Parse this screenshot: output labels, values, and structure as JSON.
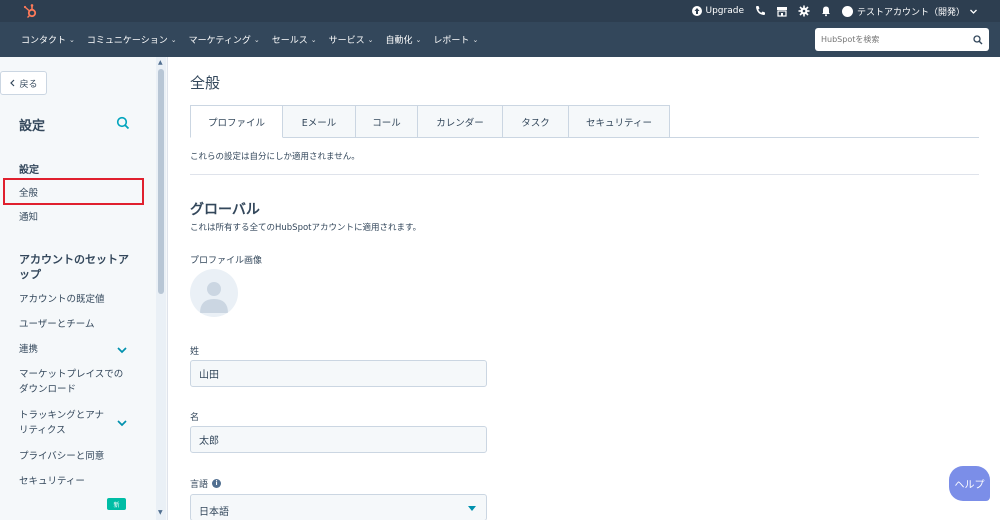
{
  "topbar": {
    "upgrade_label": "Upgrade",
    "account_label": "テストアカウント（開発）",
    "brand_color": "#ff7a59"
  },
  "nav": {
    "items": [
      {
        "label": "コンタクト"
      },
      {
        "label": "コミュニケーション"
      },
      {
        "label": "マーケティング"
      },
      {
        "label": "セールス"
      },
      {
        "label": "サービス"
      },
      {
        "label": "自動化"
      },
      {
        "label": "レポート"
      }
    ],
    "search_placeholder": "HubSpotを検索"
  },
  "sidebar": {
    "back_label": "戻る",
    "title": "設定",
    "section_settings": "設定",
    "item_general": "全般",
    "item_notifications": "通知",
    "section_account": "アカウントのセットアップ",
    "item_account_defaults": "アカウントの既定値",
    "item_users_teams": "ユーザーとチーム",
    "item_integrations": "連携",
    "item_marketplace": "マーケットプレイスでのダウンロード",
    "item_tracking": "トラッキングとアナリティクス",
    "item_privacy": "プライバシーと同意",
    "item_security": "セキュリティー",
    "new_badge": "新"
  },
  "main": {
    "page_title": "全般",
    "tabs": [
      {
        "label": "プロファイル"
      },
      {
        "label": "Eメール"
      },
      {
        "label": "コール"
      },
      {
        "label": "カレンダー"
      },
      {
        "label": "タスク"
      },
      {
        "label": "セキュリティー"
      }
    ],
    "note": "これらの設定は自分にしか適用されません。",
    "global_title": "グローバル",
    "global_desc": "これは所有する全てのHubSpotアカウントに適用されます。",
    "profile_image_label": "プロファイル画像",
    "last_name_label": "姓",
    "last_name_value": "山田",
    "first_name_label": "名",
    "first_name_value": "太郎",
    "language_label": "言語",
    "language_value": "日本語"
  },
  "help_label": "ヘルプ"
}
